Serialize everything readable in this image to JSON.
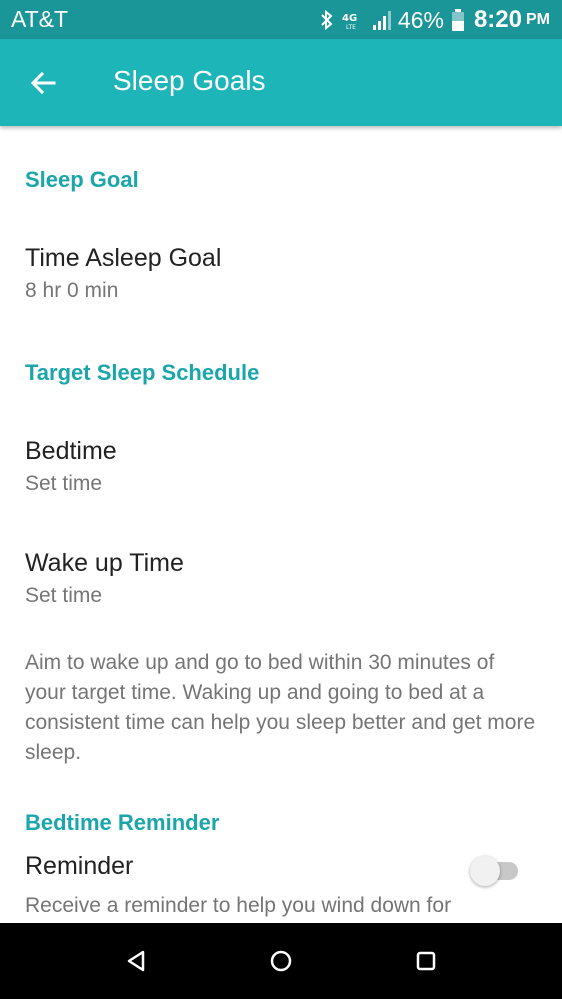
{
  "status_bar": {
    "carrier": "AT&T",
    "network_type": "4G LTE",
    "battery_percent": "46%",
    "time": "8:20",
    "ampm": "PM",
    "icons": [
      "bluetooth-icon",
      "lte-icon",
      "signal-icon",
      "battery-icon"
    ]
  },
  "app_bar": {
    "back_icon": "arrow-left-icon",
    "title": "Sleep Goals",
    "color": "#1eb5b9"
  },
  "sections": {
    "sleep_goal": {
      "header": "Sleep Goal",
      "time_asleep_title": "Time Asleep Goal",
      "time_asleep_value": "8 hr 0 min"
    },
    "schedule": {
      "header": "Target Sleep Schedule",
      "bedtime_title": "Bedtime",
      "bedtime_value": "Set time",
      "wakeup_title": "Wake up Time",
      "wakeup_value": "Set time",
      "description": "Aim to wake up and go to bed within 30 minutes of your target time. Waking up and going to bed at a consistent time can help you sleep better and get more sleep."
    },
    "reminder": {
      "header": "Bedtime Reminder",
      "title": "Reminder",
      "description": "Receive a reminder to help you wind down for",
      "enabled": false
    }
  },
  "nav_bar": {
    "icons": [
      "back-triangle-icon",
      "home-circle-icon",
      "recents-square-icon"
    ]
  },
  "colors": {
    "accent": "#1aa6aa",
    "status_bar": "#1a9598",
    "secondary_text": "#757575"
  }
}
